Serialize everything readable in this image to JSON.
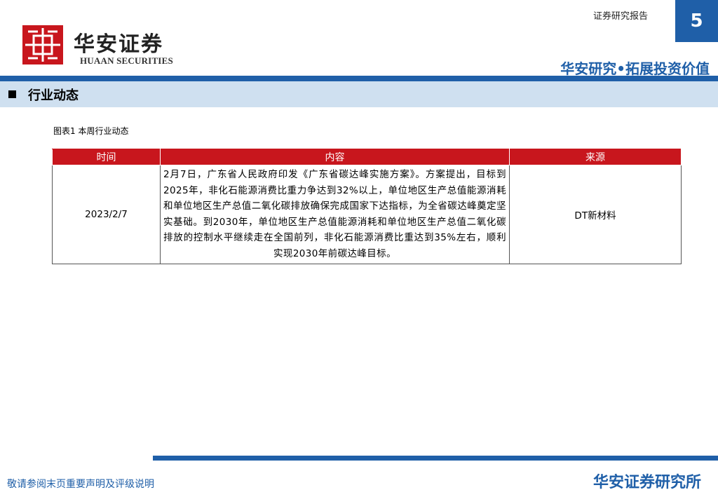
{
  "header": {
    "logo_cn": "华安证券",
    "logo_en": "HUAAN SECURITIES",
    "report_type": "证券研究报告",
    "page_number": "5",
    "slogan": "华安研究•拓展投资价值"
  },
  "section": {
    "title": "行业动态"
  },
  "figure": {
    "caption": "图表1 本周行业动态"
  },
  "table": {
    "headers": {
      "time": "时间",
      "content": "内容",
      "source": "来源"
    },
    "rows": [
      {
        "time": "2023/2/7",
        "content": "2月7日，广东省人民政府印发《广东省碳达峰实施方案》。方案提出，目标到2025年，非化石能源消费比重力争达到32%以上，单位地区生产总值能源消耗和单位地区生产总值二氧化碳排放确保完成国家下达指标，为全省碳达峰奠定坚实基础。到2030年，单位地区生产总值能源消耗和单位地区生产总值二氧化碳排放的控制水平继续走在全国前列，非化石能源消费比重达到35%左右，顺利实现2030年前碳达峰目标。",
        "source": "DT新材料"
      }
    ]
  },
  "footer": {
    "disclaimer": "敬请参阅末页重要声明及评级说明",
    "org": "华安证券研究所"
  },
  "colors": {
    "brand_red": "#c8161d",
    "brand_blue": "#1f5fa8",
    "section_bg": "#cfe0f0"
  }
}
